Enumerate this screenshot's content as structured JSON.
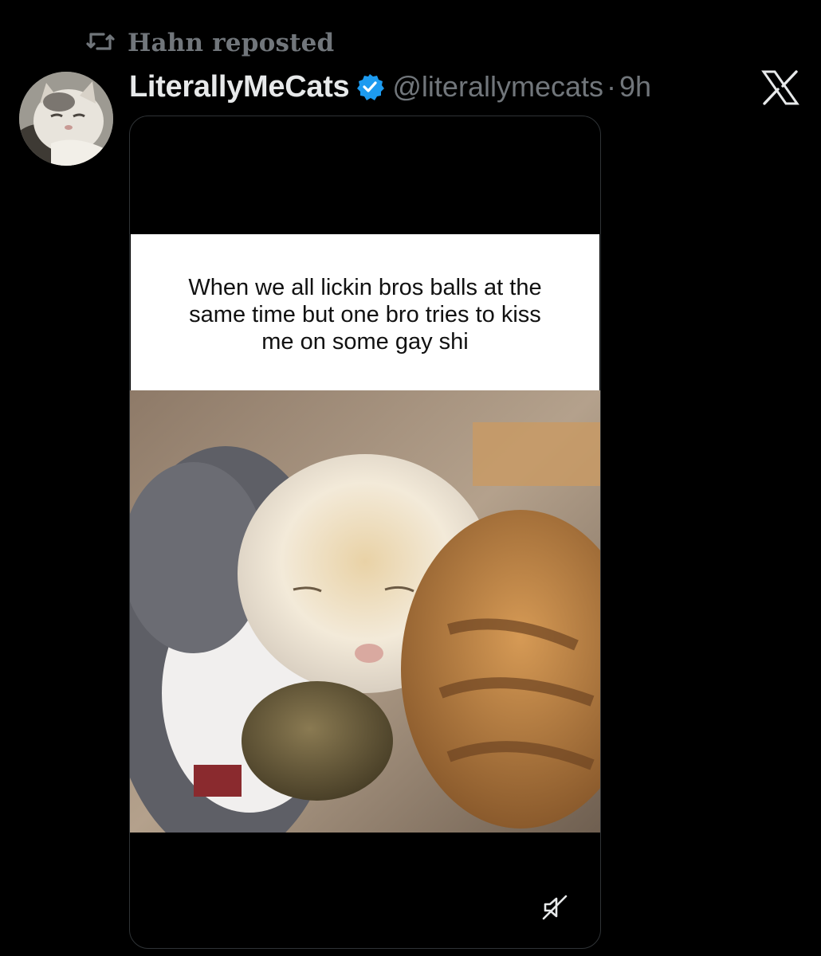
{
  "repost": {
    "text": "Hahn reposted",
    "icon": "repost-icon"
  },
  "post": {
    "display_name": "LiterallyMeCats",
    "verified": true,
    "handle": "@literallymecats",
    "separator": "·",
    "time": "9h",
    "avatar": "cat-avatar"
  },
  "brand": {
    "icon": "x-logo-icon"
  },
  "media": {
    "caption": "When we all lickin bros balls at the same time but one bro tries to kiss me on some gay shi",
    "mute_icon": "volume-muted-icon"
  },
  "colors": {
    "background": "#000000",
    "secondary_text": "#71767b",
    "primary_text": "#e7e9ea",
    "verified_blue": "#1d9bf0",
    "border": "#2f3336"
  }
}
